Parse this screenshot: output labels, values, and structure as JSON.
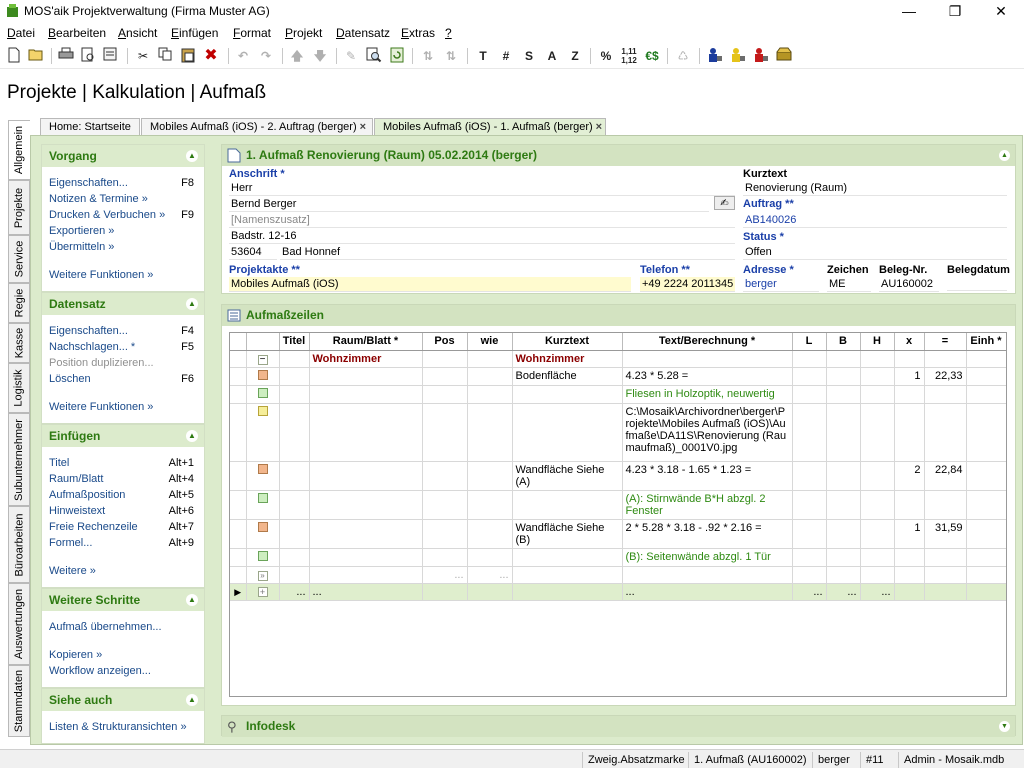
{
  "window": {
    "title": "MOS'aik Projektverwaltung (Firma Muster AG)"
  },
  "menu": [
    {
      "pre": "D",
      "rest": "atei"
    },
    {
      "pre": "B",
      "rest": "earbeiten"
    },
    {
      "pre": "A",
      "rest": "nsicht"
    },
    {
      "pre": "E",
      "rest": "infügen"
    },
    {
      "pre": "F",
      "rest": "ormat"
    },
    {
      "pre": "P",
      "rest": "rojekt"
    },
    {
      "pre": "D",
      "rest": "atensatz"
    },
    {
      "pre": "E",
      "rest": "xtras"
    },
    {
      "pre": "?",
      "rest": ""
    }
  ],
  "toolbar_text": {
    "t": "T",
    "hash": "#",
    "s": "S",
    "a": "A",
    "z": "Z",
    "pct": "%",
    "euro": "€$"
  },
  "page_title": "Projekte | Kalkulation | Aufmaß",
  "left_tabs": [
    "Allgemein",
    "Projekte",
    "Service",
    "Regie",
    "Kasse",
    "Logistik",
    "Subunternehmer",
    "Büroarbeiten",
    "Auswertungen",
    "Stammdaten"
  ],
  "doc_tabs": [
    {
      "label": "Home: Startseite",
      "closable": false
    },
    {
      "label": "Mobiles Aufmaß (iOS) - 2. Auftrag (berger)",
      "closable": true
    },
    {
      "label": "Mobiles Aufmaß (iOS) - 1. Aufmaß (berger)",
      "closable": true
    }
  ],
  "sidebar": {
    "vorgang": {
      "title": "Vorgang",
      "items": [
        {
          "label": "Eigenschaften...",
          "key": "F8"
        },
        {
          "label": "Notizen & Termine »",
          "key": ""
        },
        {
          "label": "Drucken & Verbuchen »",
          "key": "F9"
        },
        {
          "label": "Exportieren »",
          "key": ""
        },
        {
          "label": "Übermitteln »",
          "key": ""
        }
      ],
      "more": "Weitere Funktionen »"
    },
    "datensatz": {
      "title": "Datensatz",
      "items": [
        {
          "label": "Eigenschaften...",
          "key": "F4"
        },
        {
          "label": "Nachschlagen... *",
          "key": "F5"
        },
        {
          "label": "Position duplizieren...",
          "key": ""
        },
        {
          "label": "Löschen",
          "key": "F6"
        }
      ],
      "more": "Weitere Funktionen »"
    },
    "einfuegen": {
      "title": "Einfügen",
      "items": [
        {
          "label": "Titel",
          "key": "Alt+1"
        },
        {
          "label": "Raum/Blatt",
          "key": "Alt+4"
        },
        {
          "label": "Aufmaßposition",
          "key": "Alt+5"
        },
        {
          "label": "Hinweistext",
          "key": "Alt+6"
        },
        {
          "label": "Freie Rechenzeile",
          "key": "Alt+7"
        },
        {
          "label": "Formel...",
          "key": "Alt+9"
        }
      ],
      "more": "Weitere »"
    },
    "weitere": {
      "title": "Weitere Schritte",
      "items": [
        "Aufmaß übernehmen...",
        "Kopieren »",
        "Workflow anzeigen..."
      ]
    },
    "siehe": {
      "title": "Siehe auch",
      "items": [
        "Listen & Strukturansichten »"
      ]
    }
  },
  "header_card": {
    "title": "1. Aufmaß Renovierung (Raum) 05.02.2014 (berger)",
    "anschrift_label": "Anschrift *",
    "anrede": "Herr",
    "name": "Bernd Berger",
    "namenszusatz": "[Namenszusatz]",
    "strasse": "Badstr. 12-16",
    "plz": "53604",
    "ort": "Bad Honnef",
    "kurztext_label": "Kurztext",
    "kurztext": "Renovierung (Raum)",
    "auftrag_label": "Auftrag **",
    "auftrag": "AB140026",
    "status_label": "Status *",
    "status": "Offen",
    "projektakte_label": "Projektakte **",
    "projektakte": "Mobiles Aufmaß (iOS)",
    "telefon_label": "Telefon **",
    "telefon": "+49 2224 2011345",
    "adresse_label": "Adresse *",
    "adresse": "berger",
    "zeichen_label": "Zeichen",
    "zeichen": "ME",
    "belegnr_label": "Beleg-Nr.",
    "belegnr": "AU160002",
    "belegdatum_label": "Belegdatum",
    "belegdatum": ""
  },
  "rows_card": {
    "title": "Aufmaßzeilen"
  },
  "grid": {
    "columns": [
      "",
      "",
      "Titel",
      "Raum/Blatt *",
      "Pos",
      "wie",
      "Kurztext",
      "Text/Berechnung *",
      "L",
      "B",
      "H",
      "x",
      "=",
      "Einh *"
    ],
    "rows": [
      {
        "icon": "minus",
        "raum": "Wohnzimmer",
        "kurz": "Wohnzimmer",
        "text": "",
        "x": "",
        "eq": "",
        "kind": "room"
      },
      {
        "icon": "orange",
        "raum": "",
        "kurz": "Bodenfläche",
        "text": "4.23 * 5.28 =",
        "x": "1",
        "eq": "22,33",
        "kind": "calc"
      },
      {
        "icon": "green",
        "raum": "",
        "kurz": "",
        "text": "Fliesen in Holzoptik, neuwertig",
        "x": "",
        "eq": "",
        "kind": "note"
      },
      {
        "icon": "yellow",
        "raum": "",
        "kurz": "",
        "text": "C:\\Mosaik\\Archivordner\\berger\\Projekte\\Mobiles Aufmaß (iOS)\\Aufmaße\\DA11S\\Renovierung (Raumaufmaß)_0001V0.jpg",
        "x": "",
        "eq": "",
        "kind": "file"
      },
      {
        "icon": "orange",
        "raum": "",
        "kurz": "Wandfläche Siehe (A)",
        "text": "4.23 * 3.18 - 1.65 * 1.23 =",
        "x": "2",
        "eq": "22,84",
        "kind": "calc"
      },
      {
        "icon": "green",
        "raum": "",
        "kurz": "",
        "text": "(A): Stirnwände B*H abzgl. 2 Fenster",
        "x": "",
        "eq": "",
        "kind": "note"
      },
      {
        "icon": "orange",
        "raum": "",
        "kurz": "Wandfläche Siehe (B)",
        "text": "2 * 5.28 * 3.18 - .92 * 2.16 =",
        "x": "1",
        "eq": "31,59",
        "kind": "calc"
      },
      {
        "icon": "green",
        "raum": "",
        "kurz": "",
        "text": "(B): Seitenwände abzgl. 1 Tür",
        "x": "",
        "eq": "",
        "kind": "note"
      },
      {
        "icon": "expand",
        "raum": "",
        "kurz": "",
        "text": "",
        "x": "",
        "eq": "",
        "kind": "blank"
      },
      {
        "icon": "plus",
        "raum": "...",
        "kurz": "",
        "text": "...",
        "x": "",
        "eq": "",
        "kind": "new"
      }
    ],
    "dots": "..."
  },
  "infodesk": {
    "title": "Infodesk"
  },
  "statusbar": [
    "Zweig.Absatzmarke",
    "1. Aufmaß (AU160002)",
    "berger",
    "#11",
    "Admin - Mosaik.mdb"
  ],
  "colors": {
    "accent_green": "#2e7a12",
    "panel_bg": "#dcebcc",
    "label_blue": "#1a3fa8",
    "room_red": "#8b0000"
  }
}
